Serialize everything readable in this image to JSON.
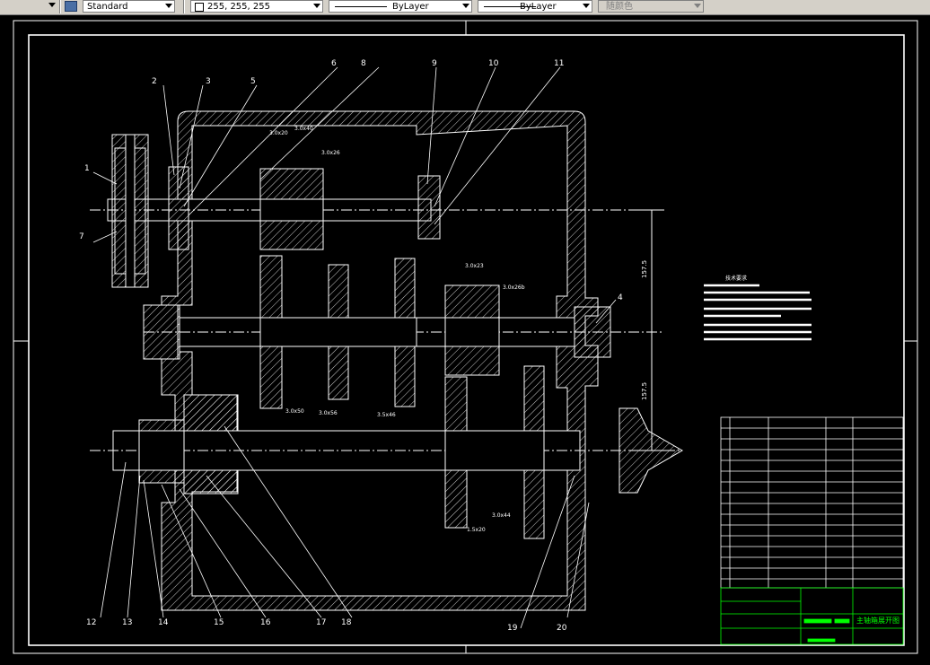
{
  "toolbar": {
    "text_style": "Standard",
    "color": "255, 255, 255",
    "linetype": "ByLayer",
    "lineweight": "ByLayer",
    "plot_style": "随颜色"
  },
  "drawing": {
    "balloons": [
      "1",
      "2",
      "3",
      "4",
      "5",
      "6",
      "7",
      "8",
      "9",
      "10",
      "11",
      "12",
      "13",
      "14",
      "15",
      "16",
      "17",
      "18",
      "19",
      "20"
    ],
    "gear_labels": {
      "g1": "3.0x20",
      "g2": "3.0x40",
      "g3": "3.0x26",
      "g4": "3.0x23",
      "g5": "3.0x26b",
      "g6": "3.0x50",
      "g7": "3.0x56",
      "g8": "3.5x46",
      "g9": "3.0x44",
      "g10": "1.5x20"
    },
    "dimensions": {
      "upper": "157.5",
      "lower": "157.5"
    },
    "notes_title": "技术要求",
    "title_block": {
      "drawing_name": "主轴箱展开图"
    }
  }
}
